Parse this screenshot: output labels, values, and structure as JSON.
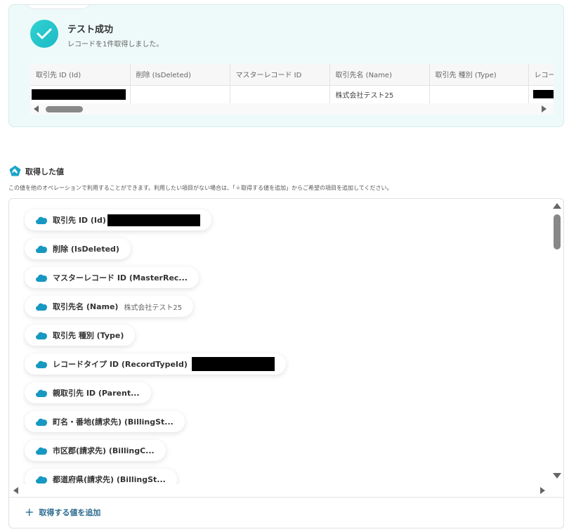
{
  "result": {
    "title": "テスト成功",
    "subtitle": "レコードを1件取得しました。",
    "columns": [
      "取引先 ID (Id)",
      "削除 (IsDeleted)",
      "マスターレコード ID",
      "取引先名 (Name)",
      "取引先 種別 (Type)",
      "レコー"
    ],
    "row": [
      "",
      "",
      "",
      "株式会社テスト25",
      "",
      ""
    ]
  },
  "acquired": {
    "title": "取得した値",
    "description": "この値を他のオペレーションで利用することができます。利用したい項目がない場合は、「＋取得する値を追加」からご希望の項目を追加してください。",
    "items": [
      {
        "label": "取引先 ID (Id)",
        "value": ""
      },
      {
        "label": "削除 (IsDeleted)",
        "value": ""
      },
      {
        "label": "マスターレコード ID (MasterRec...",
        "value": ""
      },
      {
        "label": "取引先名 (Name)",
        "value": "株式会社テスト25"
      },
      {
        "label": "取引先 種別 (Type)",
        "value": ""
      },
      {
        "label": "レコードタイプ ID (RecordTypeId)",
        "value": ""
      },
      {
        "label": "親取引先 ID (Parent...",
        "value": ""
      },
      {
        "label": "町名・番地(請求先) (BillingSt...",
        "value": ""
      },
      {
        "label": "市区郡(請求先) (BillingC...",
        "value": ""
      },
      {
        "label": "都道府県(請求先) (BillingSt...",
        "value": ""
      }
    ],
    "add_label": "取得する値を追加"
  },
  "colors": {
    "accent": "#1db9c7",
    "card_bg": "#eefaf9",
    "link": "#2b6b8f",
    "salesforce_blue": "#1798c1"
  }
}
